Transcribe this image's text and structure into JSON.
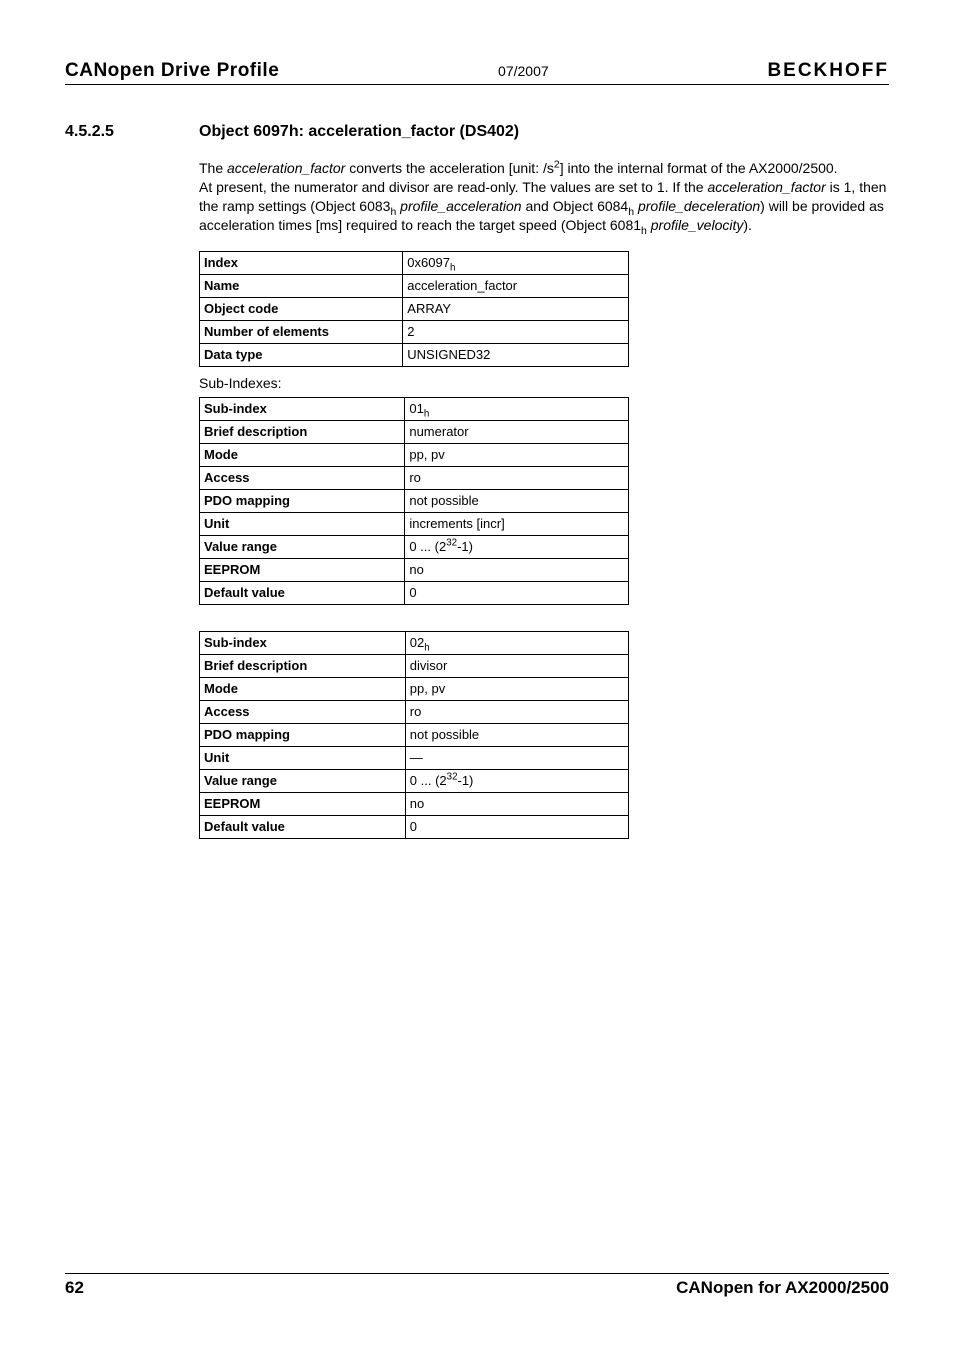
{
  "header": {
    "left": "CANopen Drive Profile",
    "mid": "07/2007",
    "right": "BECKHOFF"
  },
  "section": {
    "number": "4.5.2.5",
    "title": "Object 6097h: acceleration_factor (DS402)"
  },
  "paragraph": {
    "p1_a": "The ",
    "p1_it1": "acceleration_factor",
    "p1_b": " converts the acceleration [unit: /s",
    "p1_sup": "2",
    "p1_c": "] into the internal format of the AX2000/2500.",
    "p2_a": "At present, the numerator and divisor are read-only. The values are set to 1. If the ",
    "p2_it1": "acceleration_factor",
    "p2_b": " is 1, then the ramp settings (Object 6083",
    "p2_sub1": "h",
    "p2_c": " ",
    "p2_it2": "profile_acceleration",
    "p2_d": " and Object 6084",
    "p2_sub2": "h",
    "p2_e": " ",
    "p2_it3": "profile_deceleration",
    "p2_f": ") will be provided as acceleration times [ms] required to reach the target speed (Object 6081",
    "p2_sub3": "h",
    "p2_g": " ",
    "p2_it4": "profile_velocity",
    "p2_h": ")."
  },
  "tables": {
    "main": [
      {
        "label": "Index",
        "value_html": "0x6097<sub>h</sub>"
      },
      {
        "label": "Name",
        "value_html": "acceleration_factor"
      },
      {
        "label": "Object code",
        "value_html": "ARRAY"
      },
      {
        "label": "Number of elements",
        "value_html": "2"
      },
      {
        "label": "Data type",
        "value_html": "UNSIGNED32"
      }
    ],
    "sub_label": "Sub-Indexes:",
    "sub1": [
      {
        "label": "Sub-index",
        "value_html": "01<sub>h</sub>"
      },
      {
        "label": "Brief description",
        "value_html": "numerator"
      },
      {
        "label": "Mode",
        "value_html": "pp, pv"
      },
      {
        "label": "Access",
        "value_html": "ro"
      },
      {
        "label": "PDO mapping",
        "value_html": "not possible"
      },
      {
        "label": "Unit",
        "value_html": "increments [incr]"
      },
      {
        "label": "Value range",
        "value_html": "0 ... (2<sup>32</sup>-1)"
      },
      {
        "label": "EEPROM",
        "value_html": "no"
      },
      {
        "label": "Default value",
        "value_html": "0"
      }
    ],
    "sub2": [
      {
        "label": "Sub-index",
        "value_html": "02<sub>h</sub>"
      },
      {
        "label": "Brief description",
        "value_html": "divisor"
      },
      {
        "label": "Mode",
        "value_html": "pp, pv"
      },
      {
        "label": "Access",
        "value_html": "ro"
      },
      {
        "label": "PDO mapping",
        "value_html": "not possible"
      },
      {
        "label": "Unit",
        "value_html": "—"
      },
      {
        "label": "Value range",
        "value_html": "0 ... (2<sup>32</sup>-1)"
      },
      {
        "label": "EEPROM",
        "value_html": "no"
      },
      {
        "label": "Default value",
        "value_html": "0"
      }
    ]
  },
  "footer": {
    "left": "62",
    "right": "CANopen for AX2000/2500"
  }
}
